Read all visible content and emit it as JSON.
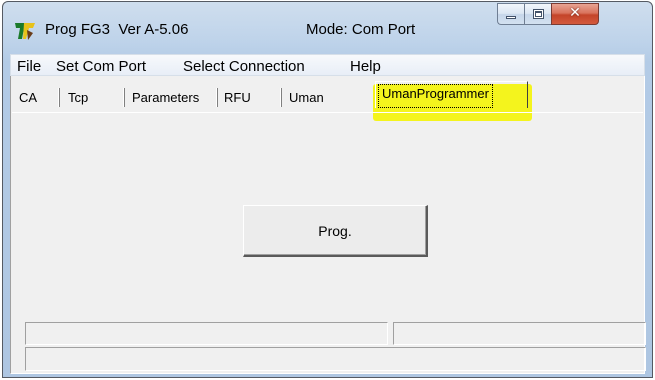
{
  "window": {
    "title": "Prog FG3  Ver A-5.06",
    "mode": "Mode: Com Port"
  },
  "menu": [
    "File",
    "Set Com Port",
    "Select Connection",
    "Help"
  ],
  "tabs": [
    "CA",
    "Tcp",
    "Parameters",
    "RFU",
    "Uman"
  ],
  "active_tab": "UmanProgrammer",
  "prog_button": "Prog.",
  "colors": {
    "title_gradient_top": "#cfdeee",
    "highlight": "#f4f41d",
    "client_bg": "#f0f0f0",
    "close_button": "#c4442a"
  },
  "icons": {
    "app": "app-logo-icon",
    "minimize": "minimize-icon",
    "maximize": "maximize-icon",
    "close": "close-icon"
  }
}
